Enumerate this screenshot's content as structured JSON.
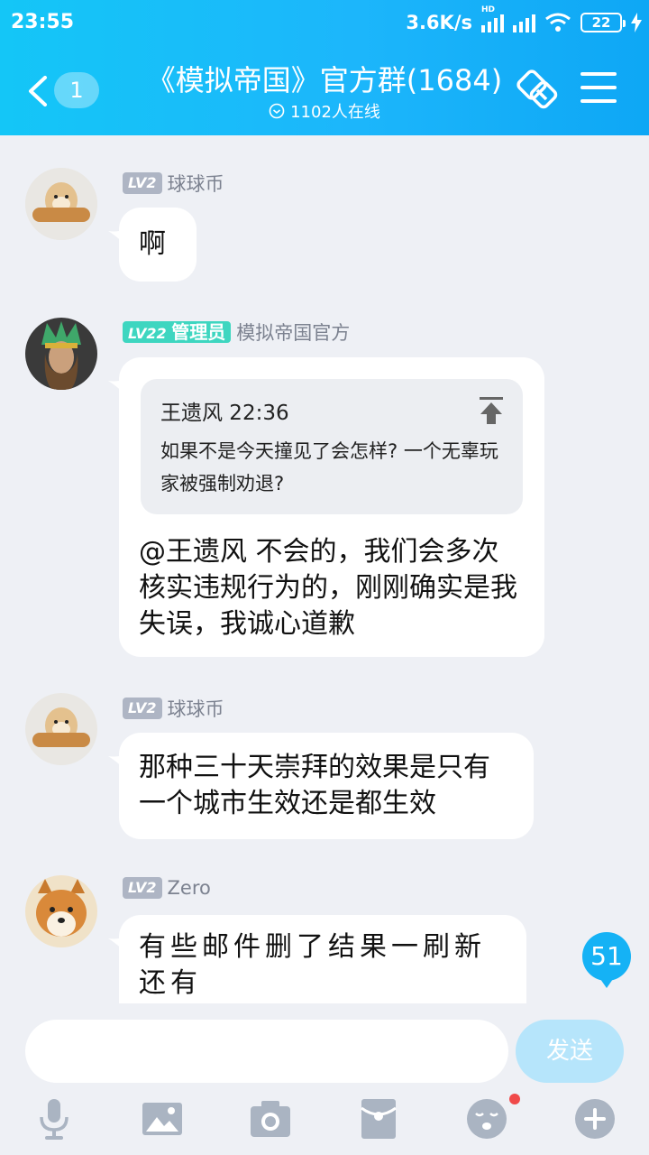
{
  "status_bar": {
    "time": "23:55",
    "network_speed": "3.6K/s",
    "hd_label": "HD",
    "battery": "22"
  },
  "header": {
    "back_count": "1",
    "title": "《模拟帝国》官方群(1684)",
    "online": "1102人在线",
    "icons": [
      "back-chevron-icon",
      "group-link-icon",
      "menu-icon"
    ]
  },
  "messages": [
    {
      "level": "LV2",
      "sender": "球球币",
      "text": "啊"
    },
    {
      "level": "LV22",
      "role": "管理员",
      "sender": "模拟帝国官方",
      "quote": {
        "header": "王遗风 22:36",
        "text": "如果不是今天撞见了会怎样? 一个无辜玩家被强制劝退?"
      },
      "text": "@王遗风 不会的，我们会多次核实违规行为的，刚刚确实是我失误，我诚心道歉"
    },
    {
      "level": "LV2",
      "sender": "球球币",
      "text": "那种三十天崇拜的效果是只有一个城市生效还是都生效"
    },
    {
      "level": "LV2",
      "sender": "Zero",
      "text": "有些邮件删了结果一刷新还有"
    }
  ],
  "unread_badge": "51",
  "input": {
    "placeholder": "",
    "send_label": "发送"
  },
  "toolbar": [
    "microphone-icon",
    "image-icon",
    "camera-icon",
    "red-envelope-icon",
    "emoji-icon",
    "plus-icon"
  ],
  "colors": {
    "header_start": "#14c6f7",
    "header_end": "#0ea7f5",
    "chat_bg": "#eef0f5",
    "badge": "#15b2f5",
    "send_button": "#b6e5fb"
  }
}
